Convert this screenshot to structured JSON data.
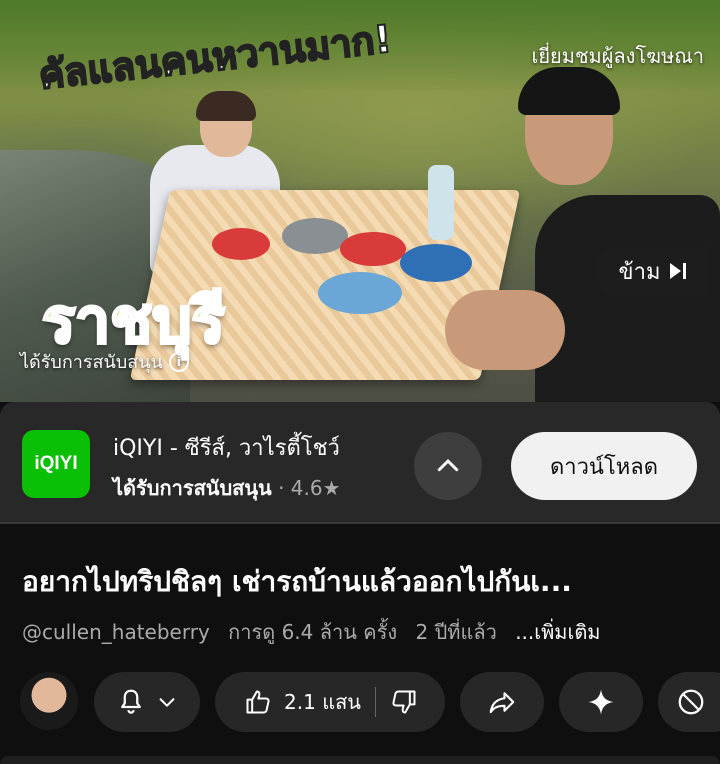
{
  "video": {
    "overlay_title": "คัลแลนคนหวานมาก!",
    "sponsor_visit": "เยี่ยมชมผู้ลงโฆษณา",
    "province": "ราชบุรี",
    "sponsored_note": "ได้รับการสนับสนุน",
    "skip_label": "ข้าม"
  },
  "ad": {
    "logo_text": "iQIYI",
    "app_name": "iQIYI - ซีรีส์, วาไรตี้โชว์",
    "sponsored": "ได้รับการสนับสนุน",
    "separator": "·",
    "rating": "4.6★",
    "download_label": "ดาวน์โหลด",
    "brand_color": "#0bbe06"
  },
  "title": "อยากไปทริปชิลๆ เช่ารถบ้านแล้วออกไปกันเ...",
  "meta": {
    "channel": "@cullen_hateberry",
    "views": "การดู 6.4 ล้าน ครั้ง",
    "age": "2 ปีที่แล้ว",
    "more": "...เพิ่มเติม"
  },
  "actions": {
    "likes": "2.1 แสน",
    "icons": [
      "bell-icon",
      "chevron-down-icon",
      "thumbs-up-icon",
      "thumbs-down-icon",
      "share-icon",
      "sparkle-icon",
      "block-icon"
    ]
  }
}
